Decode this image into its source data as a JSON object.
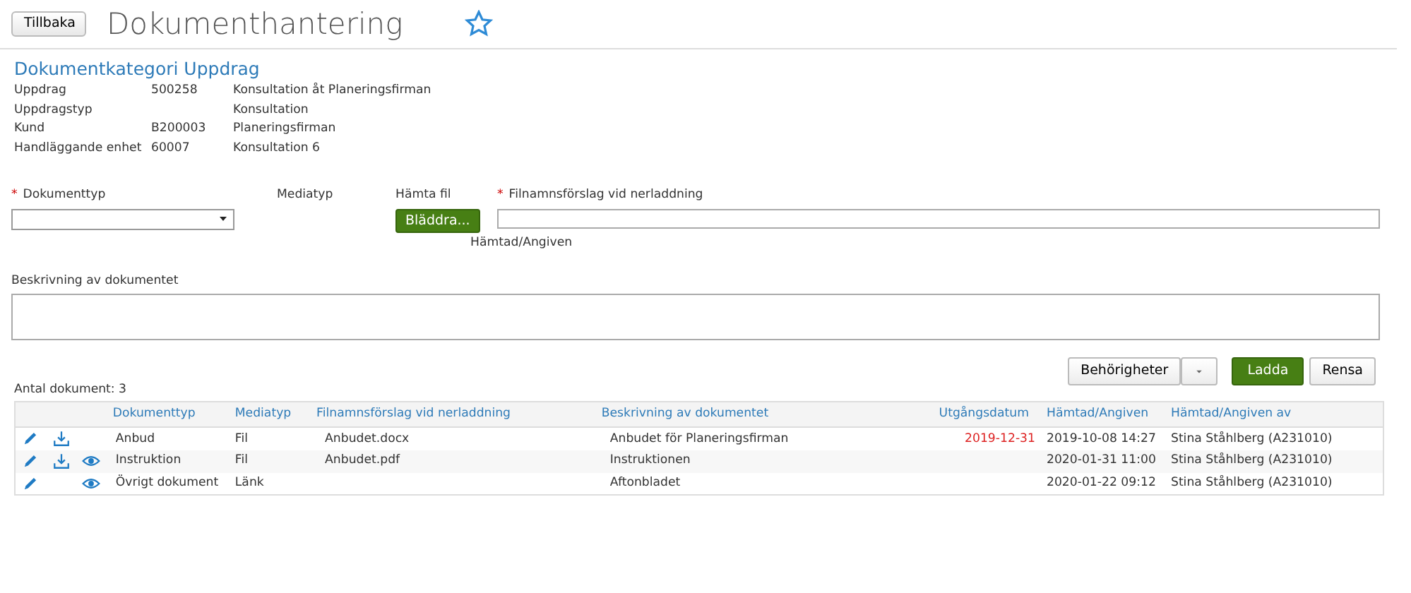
{
  "header": {
    "back": "Tillbaka",
    "title": "Dokumenthantering",
    "favorite": false
  },
  "category": {
    "title": "Dokumentkategori Uppdrag",
    "rows": [
      {
        "label": "Uppdrag",
        "code": "500258",
        "value": "Konsultation åt Planeringsfirman"
      },
      {
        "label": "Uppdragstyp",
        "value": "Konsultation"
      },
      {
        "label": "Kund",
        "code": "B200003",
        "value": "Planeringsfirman"
      },
      {
        "label": "Handläggande enhet",
        "code": "60007",
        "value": "Konsultation 6"
      }
    ]
  },
  "form": {
    "required_mark": "*",
    "doctype_label": "Dokumenttyp",
    "doctype_required": true,
    "mediatype_label": "Mediatyp",
    "fetch_label": "Hämta fil",
    "browse": "Bläddra...",
    "filename_label": "Filnamnsförslag vid nerladdning",
    "filename_required": true,
    "fetched_label": "Hämtad/Angiven",
    "description_label": "Beskrivning av dokumentet"
  },
  "actions": {
    "permissions": "Behörigheter",
    "load": "Ladda",
    "clear": "Rensa"
  },
  "count": "Antal dokument: 3",
  "table": {
    "columns": [
      "Dokumenttyp",
      "Mediatyp",
      "Filnamnsförslag vid nerladdning",
      "Beskrivning av dokumentet",
      "Utgångsdatum",
      "Hämtad/Angiven",
      "Hämtad/Angiven av"
    ],
    "rows": [
      {
        "edit": true,
        "download": true,
        "view": false,
        "cells": [
          "Anbud",
          "Fil",
          "Anbudet.docx",
          "Anbudet för Planeringsfirman",
          "2019-12-31",
          "2019-10-08 14:27",
          "Stina Ståhlberg (A231010)"
        ],
        "expired": true
      },
      {
        "edit": true,
        "download": true,
        "view": true,
        "cells": [
          "Instruktion",
          "Fil",
          "Anbudet.pdf",
          "Instruktionen",
          "",
          "2020-01-31 11:00",
          "Stina Ståhlberg (A231010)"
        ]
      },
      {
        "edit": true,
        "download": false,
        "view": true,
        "cells": [
          "Övrigt dokument",
          "Länk",
          "",
          "Aftonbladet",
          "",
          "2020-01-22 09:12",
          "Stina Ståhlberg (A231010)"
        ]
      }
    ]
  }
}
